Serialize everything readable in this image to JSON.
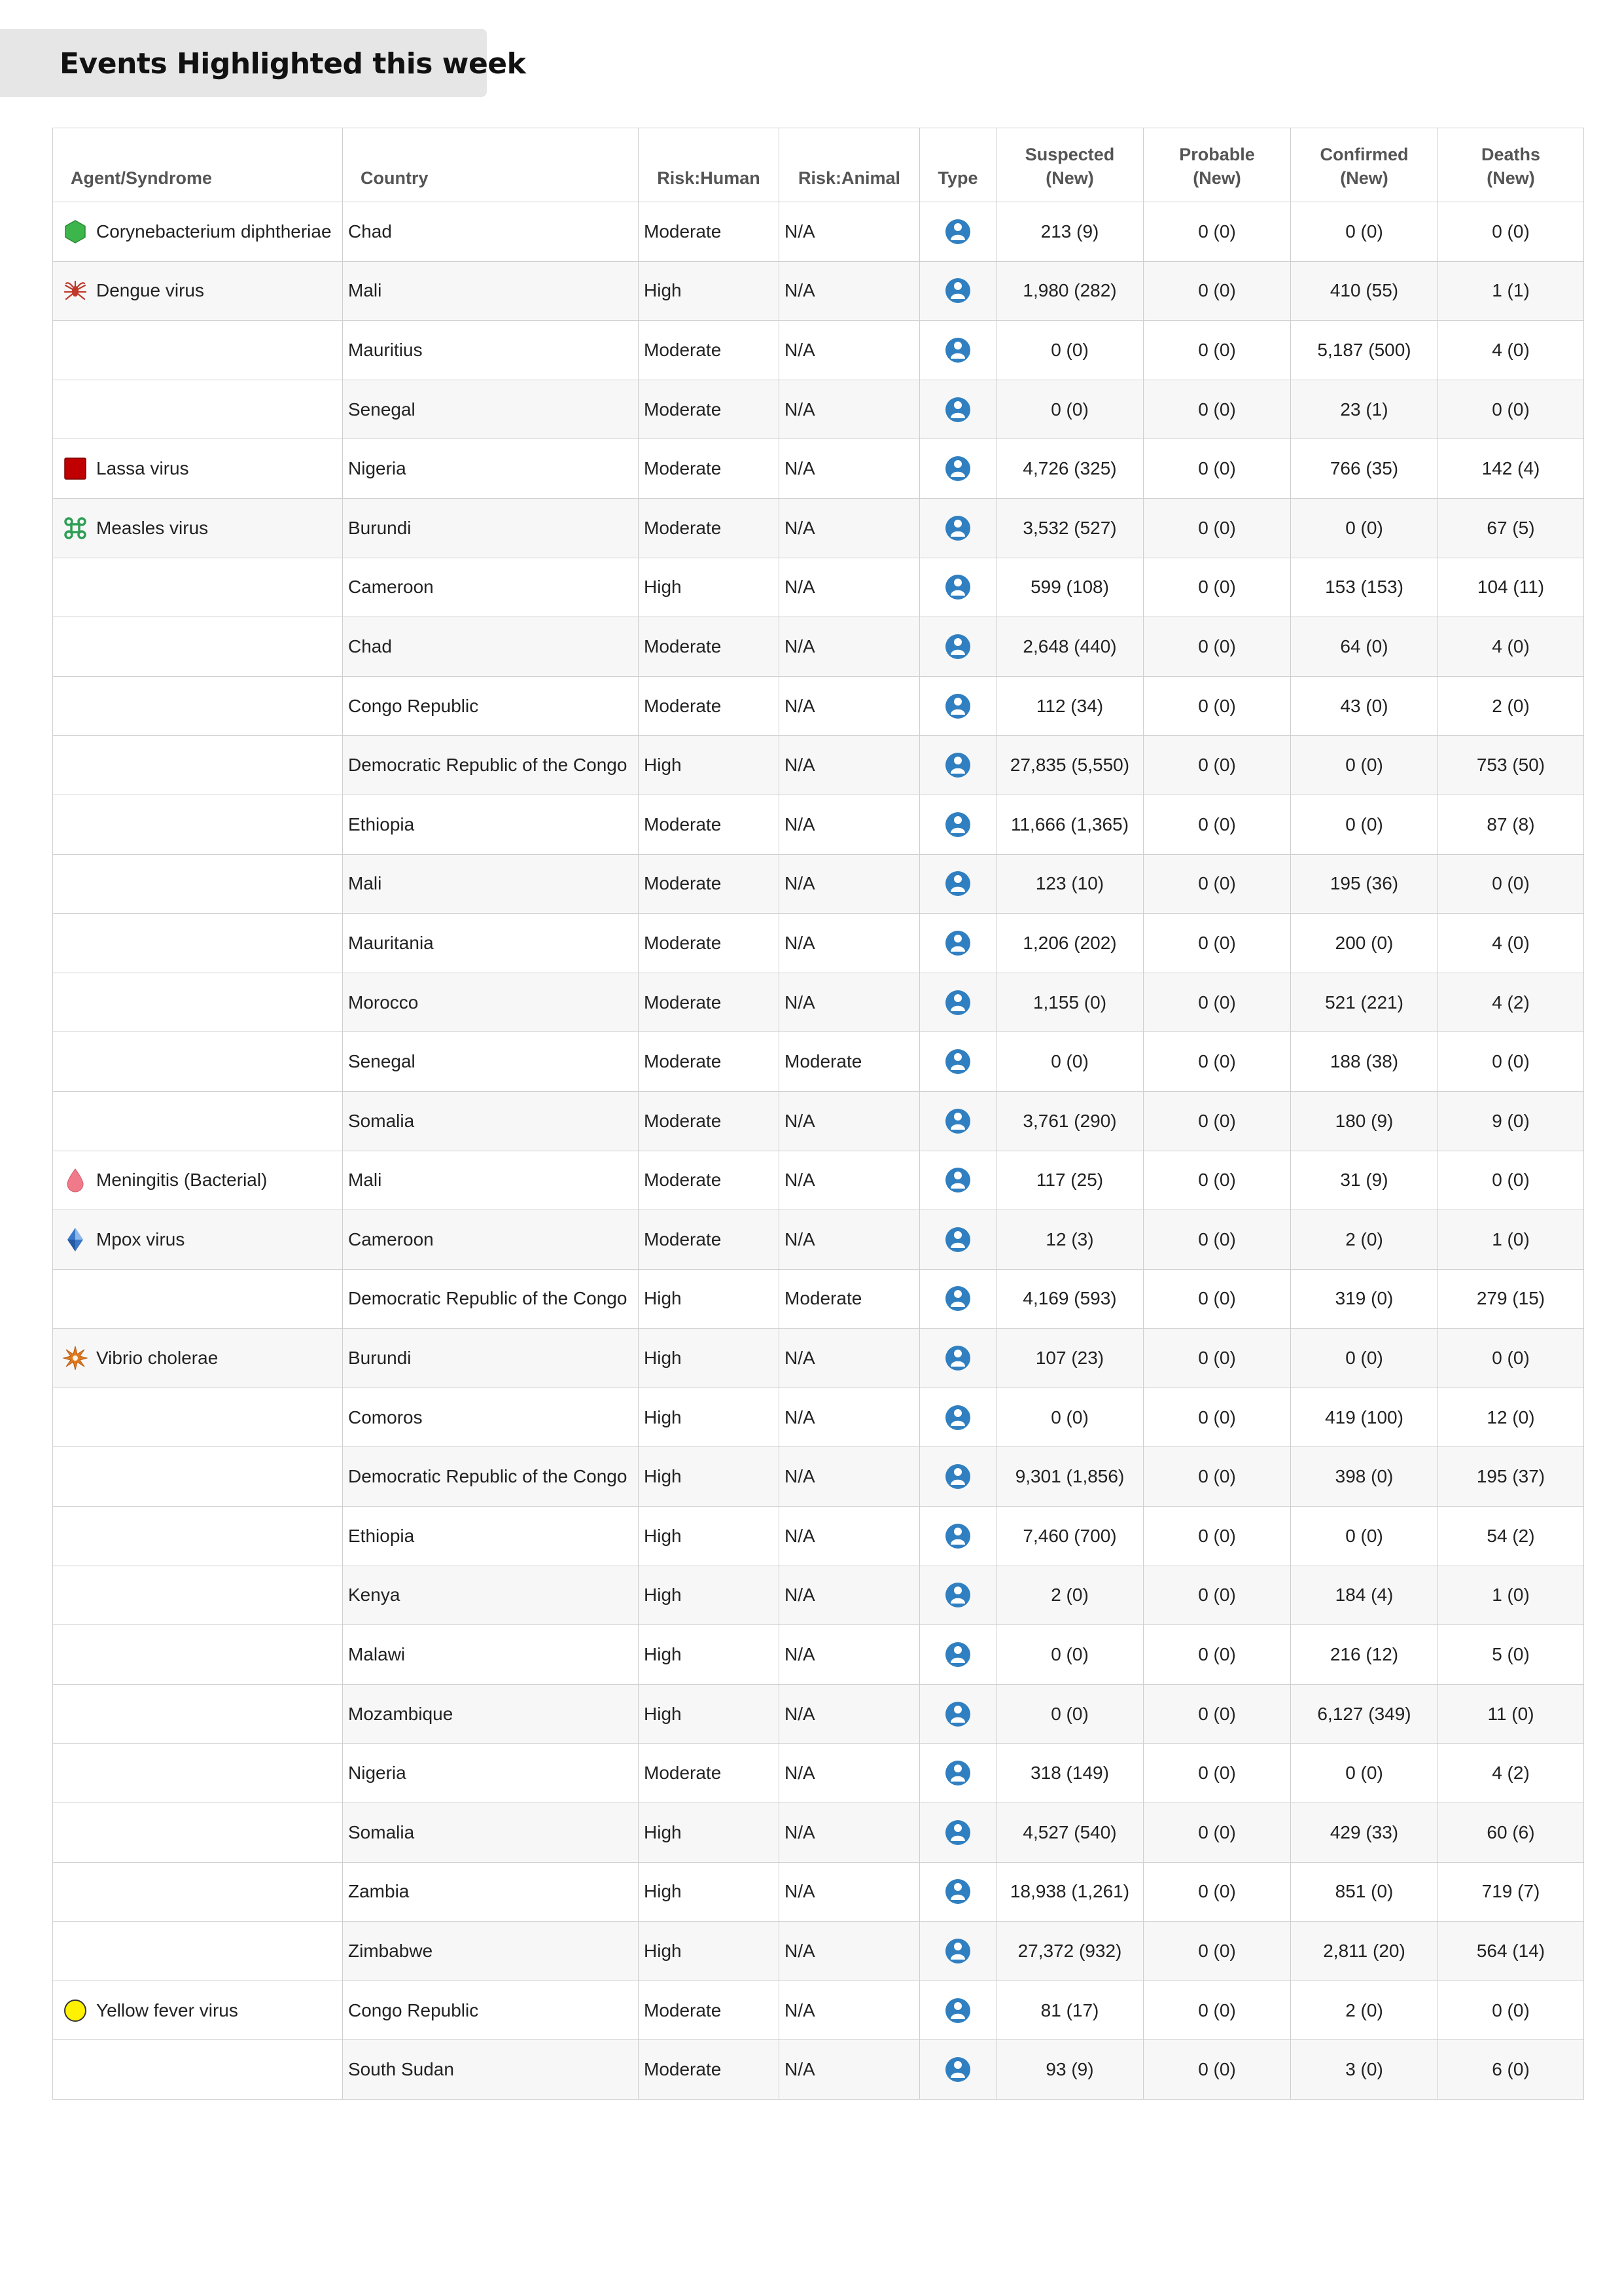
{
  "title": "Events Highlighted this week",
  "columns": {
    "agent": "Agent/Syndrome",
    "country": "Country",
    "risk_human": "Risk:Human",
    "risk_animal": "Risk:Animal",
    "type": "Type",
    "suspected": [
      "Suspected",
      "(New)"
    ],
    "probable": [
      "Probable",
      "(New)"
    ],
    "confirmed": [
      "Confirmed",
      "(New)"
    ],
    "deaths": [
      "Deaths",
      "(New)"
    ]
  },
  "icon_colors": {
    "diphtheria": "#3cb54a",
    "dengue": "#c0392b",
    "lassa": "#c00000",
    "measles": "#2e9e55",
    "meningitis": "#f07a8a",
    "mpox": "#3a78c9",
    "cholera": "#e07a20",
    "yellow_fever": "#fff200",
    "type_human": "#2f7fc1"
  },
  "rows": [
    {
      "agent": "Corynebacterium diphtheriae",
      "icon": "hexagon-icon",
      "country": "Chad",
      "risk_human": "Moderate",
      "risk_animal": "N/A",
      "type": "human-icon",
      "suspected": "213 (9)",
      "probable": "0 (0)",
      "confirmed": "0 (0)",
      "deaths": "0 (0)"
    },
    {
      "agent": "Dengue virus",
      "icon": "mosquito-icon",
      "country": "Mali",
      "risk_human": "High",
      "risk_animal": "N/A",
      "type": "human-icon",
      "suspected": "1,980 (282)",
      "probable": "0 (0)",
      "confirmed": "410 (55)",
      "deaths": "1 (1)"
    },
    {
      "agent": "",
      "icon": "",
      "country": "Mauritius",
      "risk_human": "Moderate",
      "risk_animal": "N/A",
      "type": "human-icon",
      "suspected": "0 (0)",
      "probable": "0 (0)",
      "confirmed": "5,187 (500)",
      "deaths": "4 (0)"
    },
    {
      "agent": "",
      "icon": "",
      "country": "Senegal",
      "risk_human": "Moderate",
      "risk_animal": "N/A",
      "type": "human-icon",
      "suspected": "0 (0)",
      "probable": "0 (0)",
      "confirmed": "23 (1)",
      "deaths": "0 (0)"
    },
    {
      "agent": "Lassa virus",
      "icon": "square-icon",
      "country": "Nigeria",
      "risk_human": "Moderate",
      "risk_animal": "N/A",
      "type": "human-icon",
      "suspected": "4,726 (325)",
      "probable": "0 (0)",
      "confirmed": "766 (35)",
      "deaths": "142 (4)"
    },
    {
      "agent": "Measles virus",
      "icon": "command-icon",
      "country": "Burundi",
      "risk_human": "Moderate",
      "risk_animal": "N/A",
      "type": "human-icon",
      "suspected": "3,532 (527)",
      "probable": "0 (0)",
      "confirmed": "0 (0)",
      "deaths": "67 (5)"
    },
    {
      "agent": "",
      "icon": "",
      "country": "Cameroon",
      "risk_human": "High",
      "risk_animal": "N/A",
      "type": "human-icon",
      "suspected": "599 (108)",
      "probable": "0 (0)",
      "confirmed": "153 (153)",
      "deaths": "104 (11)"
    },
    {
      "agent": "",
      "icon": "",
      "country": "Chad",
      "risk_human": "Moderate",
      "risk_animal": "N/A",
      "type": "human-icon",
      "suspected": "2,648 (440)",
      "probable": "0 (0)",
      "confirmed": "64 (0)",
      "deaths": "4 (0)"
    },
    {
      "agent": "",
      "icon": "",
      "country": "Congo Republic",
      "risk_human": "Moderate",
      "risk_animal": "N/A",
      "type": "human-icon",
      "suspected": "112 (34)",
      "probable": "0 (0)",
      "confirmed": "43 (0)",
      "deaths": "2 (0)"
    },
    {
      "agent": "",
      "icon": "",
      "country": "Democratic Republic of the Congo",
      "risk_human": "High",
      "risk_animal": "N/A",
      "type": "human-icon",
      "suspected": "27,835 (5,550)",
      "probable": "0 (0)",
      "confirmed": "0 (0)",
      "deaths": "753 (50)"
    },
    {
      "agent": "",
      "icon": "",
      "country": "Ethiopia",
      "risk_human": "Moderate",
      "risk_animal": "N/A",
      "type": "human-icon",
      "suspected": "11,666 (1,365)",
      "probable": "0 (0)",
      "confirmed": "0 (0)",
      "deaths": "87 (8)"
    },
    {
      "agent": "",
      "icon": "",
      "country": "Mali",
      "risk_human": "Moderate",
      "risk_animal": "N/A",
      "type": "human-icon",
      "suspected": "123 (10)",
      "probable": "0 (0)",
      "confirmed": "195 (36)",
      "deaths": "0 (0)"
    },
    {
      "agent": "",
      "icon": "",
      "country": "Mauritania",
      "risk_human": "Moderate",
      "risk_animal": "N/A",
      "type": "human-icon",
      "suspected": "1,206 (202)",
      "probable": "0 (0)",
      "confirmed": "200 (0)",
      "deaths": "4 (0)"
    },
    {
      "agent": "",
      "icon": "",
      "country": "Morocco",
      "risk_human": "Moderate",
      "risk_animal": "N/A",
      "type": "human-icon",
      "suspected": "1,155 (0)",
      "probable": "0 (0)",
      "confirmed": "521 (221)",
      "deaths": "4 (2)"
    },
    {
      "agent": "",
      "icon": "",
      "country": "Senegal",
      "risk_human": "Moderate",
      "risk_animal": "Moderate",
      "type": "human-icon",
      "suspected": "0 (0)",
      "probable": "0 (0)",
      "confirmed": "188 (38)",
      "deaths": "0 (0)"
    },
    {
      "agent": "",
      "icon": "",
      "country": "Somalia",
      "risk_human": "Moderate",
      "risk_animal": "N/A",
      "type": "human-icon",
      "suspected": "3,761 (290)",
      "probable": "0 (0)",
      "confirmed": "180 (9)",
      "deaths": "9 (0)"
    },
    {
      "agent": "Meningitis (Bacterial)",
      "icon": "droplet-icon",
      "country": "Mali",
      "risk_human": "Moderate",
      "risk_animal": "N/A",
      "type": "human-icon",
      "suspected": "117 (25)",
      "probable": "0 (0)",
      "confirmed": "31 (9)",
      "deaths": "0 (0)"
    },
    {
      "agent": "Mpox virus",
      "icon": "diamond-icon",
      "country": "Cameroon",
      "risk_human": "Moderate",
      "risk_animal": "N/A",
      "type": "human-icon",
      "suspected": "12 (3)",
      "probable": "0 (0)",
      "confirmed": "2 (0)",
      "deaths": "1 (0)"
    },
    {
      "agent": "",
      "icon": "",
      "country": "Democratic Republic of the Congo",
      "risk_human": "High",
      "risk_animal": "Moderate",
      "type": "human-icon",
      "suspected": "4,169 (593)",
      "probable": "0 (0)",
      "confirmed": "319 (0)",
      "deaths": "279 (15)"
    },
    {
      "agent": "Vibrio cholerae",
      "icon": "starburst-icon",
      "country": "Burundi",
      "risk_human": "High",
      "risk_animal": "N/A",
      "type": "human-icon",
      "suspected": "107 (23)",
      "probable": "0 (0)",
      "confirmed": "0 (0)",
      "deaths": "0 (0)"
    },
    {
      "agent": "",
      "icon": "",
      "country": "Comoros",
      "risk_human": "High",
      "risk_animal": "N/A",
      "type": "human-icon",
      "suspected": "0 (0)",
      "probable": "0 (0)",
      "confirmed": "419 (100)",
      "deaths": "12 (0)"
    },
    {
      "agent": "",
      "icon": "",
      "country": "Democratic Republic of the Congo",
      "risk_human": "High",
      "risk_animal": "N/A",
      "type": "human-icon",
      "suspected": "9,301 (1,856)",
      "probable": "0 (0)",
      "confirmed": "398 (0)",
      "deaths": "195 (37)"
    },
    {
      "agent": "",
      "icon": "",
      "country": "Ethiopia",
      "risk_human": "High",
      "risk_animal": "N/A",
      "type": "human-icon",
      "suspected": "7,460 (700)",
      "probable": "0 (0)",
      "confirmed": "0 (0)",
      "deaths": "54 (2)"
    },
    {
      "agent": "",
      "icon": "",
      "country": "Kenya",
      "risk_human": "High",
      "risk_animal": "N/A",
      "type": "human-icon",
      "suspected": "2 (0)",
      "probable": "0 (0)",
      "confirmed": "184 (4)",
      "deaths": "1 (0)"
    },
    {
      "agent": "",
      "icon": "",
      "country": "Malawi",
      "risk_human": "High",
      "risk_animal": "N/A",
      "type": "human-icon",
      "suspected": "0 (0)",
      "probable": "0 (0)",
      "confirmed": "216 (12)",
      "deaths": "5 (0)"
    },
    {
      "agent": "",
      "icon": "",
      "country": "Mozambique",
      "risk_human": "High",
      "risk_animal": "N/A",
      "type": "human-icon",
      "suspected": "0 (0)",
      "probable": "0 (0)",
      "confirmed": "6,127 (349)",
      "deaths": "11 (0)"
    },
    {
      "agent": "",
      "icon": "",
      "country": "Nigeria",
      "risk_human": "Moderate",
      "risk_animal": "N/A",
      "type": "human-icon",
      "suspected": "318 (149)",
      "probable": "0 (0)",
      "confirmed": "0 (0)",
      "deaths": "4 (2)"
    },
    {
      "agent": "",
      "icon": "",
      "country": "Somalia",
      "risk_human": "High",
      "risk_animal": "N/A",
      "type": "human-icon",
      "suspected": "4,527 (540)",
      "probable": "0 (0)",
      "confirmed": "429 (33)",
      "deaths": "60 (6)"
    },
    {
      "agent": "",
      "icon": "",
      "country": "Zambia",
      "risk_human": "High",
      "risk_animal": "N/A",
      "type": "human-icon",
      "suspected": "18,938 (1,261)",
      "probable": "0 (0)",
      "confirmed": "851 (0)",
      "deaths": "719 (7)"
    },
    {
      "agent": "",
      "icon": "",
      "country": "Zimbabwe",
      "risk_human": "High",
      "risk_animal": "N/A",
      "type": "human-icon",
      "suspected": "27,372 (932)",
      "probable": "0 (0)",
      "confirmed": "2,811 (20)",
      "deaths": "564 (14)"
    },
    {
      "agent": "Yellow fever virus",
      "icon": "circle-icon",
      "country": "Congo Republic",
      "risk_human": "Moderate",
      "risk_animal": "N/A",
      "type": "human-icon",
      "suspected": "81 (17)",
      "probable": "0 (0)",
      "confirmed": "2 (0)",
      "deaths": "0 (0)"
    },
    {
      "agent": "",
      "icon": "",
      "country": "South Sudan",
      "risk_human": "Moderate",
      "risk_animal": "N/A",
      "type": "human-icon",
      "suspected": "93 (9)",
      "probable": "0 (0)",
      "confirmed": "3 (0)",
      "deaths": "6 (0)"
    }
  ]
}
